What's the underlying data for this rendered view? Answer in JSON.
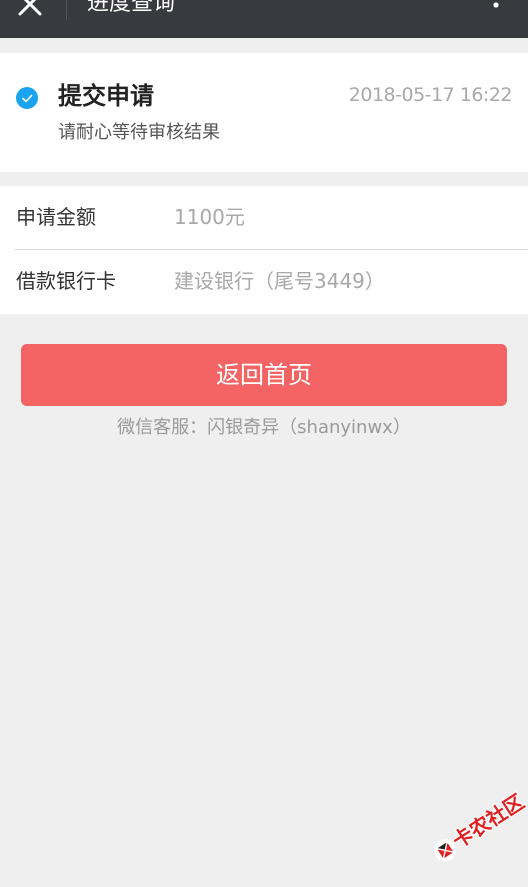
{
  "nav": {
    "title": "进度查询",
    "close_icon": "close-icon",
    "more_icon": "more-vertical-icon"
  },
  "status": {
    "icon": "check-circle-icon",
    "title": "提交申请",
    "time": "2018-05-17 16:22",
    "desc": "请耐心等待审核结果"
  },
  "info": {
    "rows": [
      {
        "label": "申请金额",
        "value": "1100元"
      },
      {
        "label": "借款银行卡",
        "value": "建设银行（尾号3449）"
      }
    ]
  },
  "actions": {
    "back_label": "返回首页"
  },
  "service": {
    "text": "微信客服：闪银奇异（shanyinwx）"
  },
  "watermark": {
    "text": "卡农社区"
  },
  "colors": {
    "nav_bg": "#393a3f",
    "accent_blue": "#1aa4f0",
    "button_red": "#f46464",
    "page_bg": "#efefef"
  }
}
